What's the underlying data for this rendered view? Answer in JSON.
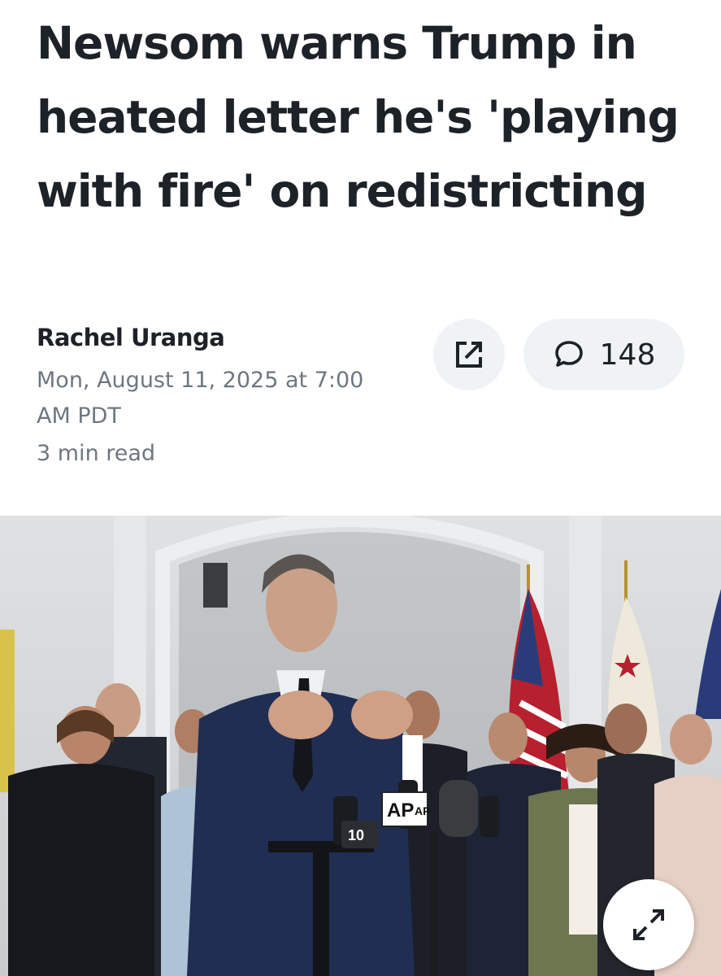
{
  "article": {
    "headline": "Newsom warns Trump in heated letter he's 'playing with fire' on redistricting",
    "author": "Rachel Uranga",
    "date": "Mon, August 11, 2025 at 7:00 AM PDT",
    "read_time": "3 min read"
  },
  "actions": {
    "share_icon": "share-external-icon",
    "comment_icon": "comment-bubble-icon",
    "comment_count": "148"
  },
  "photo": {
    "mic_labels": [
      "AP",
      "AP",
      "10"
    ],
    "expand_icon": "expand-arrows-icon"
  }
}
